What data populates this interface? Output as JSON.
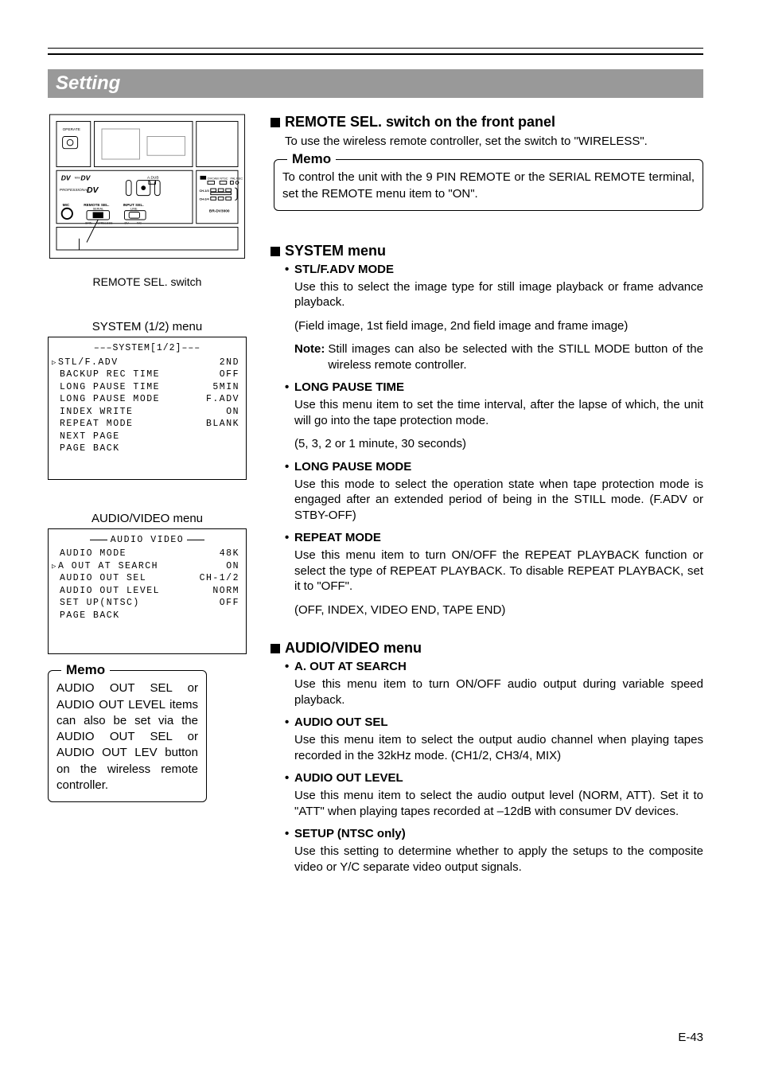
{
  "title": "Setting",
  "page_number": "E-43",
  "left": {
    "remote_switch_caption": "REMOTE SEL. switch",
    "system_menu_caption": "SYSTEM (1/2) menu",
    "system_menu_header": "–––SYSTEM[1/2]–––",
    "system_menu_items": [
      {
        "k": "STL/F.ADV",
        "v": "2ND",
        "cursor": true
      },
      {
        "k": "BACKUP REC TIME",
        "v": "OFF"
      },
      {
        "k": "LONG PAUSE TIME",
        "v": "5MIN"
      },
      {
        "k": "LONG PAUSE MODE",
        "v": "F.ADV"
      },
      {
        "k": "INDEX WRITE",
        "v": "ON"
      },
      {
        "k": "REPEAT MODE",
        "v": "BLANK"
      },
      {
        "k": "NEXT PAGE",
        "v": ""
      },
      {
        "k": "PAGE BACK",
        "v": ""
      }
    ],
    "av_menu_caption": "AUDIO/VIDEO menu",
    "av_menu_header": "AUDIO VIDEO",
    "av_menu_items": [
      {
        "k": "AUDIO MODE",
        "v": "48K"
      },
      {
        "k": "A OUT AT SEARCH",
        "v": "ON",
        "cursor": true
      },
      {
        "k": "AUDIO OUT SEL",
        "v": "CH-1/2"
      },
      {
        "k": "AUDIO OUT LEVEL",
        "v": "NORM"
      },
      {
        "k": "SET UP(NTSC)",
        "v": "OFF"
      },
      {
        "k": "PAGE BACK",
        "v": ""
      }
    ],
    "memo_title": "Memo",
    "memo_body": "AUDIO OUT SEL or AUDIO OUT LEVEL items can also be set via the AUDIO OUT SEL or AUDIO OUT LEV button on the wireless remote controller."
  },
  "right": {
    "remote_heading": "REMOTE SEL. switch on the front panel",
    "remote_lead": "To use the wireless remote controller, set the switch to \"WIRELESS\".",
    "remote_memo_title": "Memo",
    "remote_memo_body": "To control the unit with the 9 PIN REMOTE or the SERIAL REMOTE terminal, set the REMOTE menu item to \"ON\".",
    "system_heading": "SYSTEM menu",
    "system_items": [
      {
        "title": "STL/F.ADV MODE",
        "desc": "Use this to select the image type for still image playback or frame advance playback.\n(Field image, 1st field image, 2nd field image and frame image)",
        "note_label": "Note:",
        "note": "Still images can also be selected with the STILL MODE button of the wireless remote controller."
      },
      {
        "title": "LONG PAUSE TIME",
        "desc": "Use this menu item to set the time interval, after the lapse of which, the unit will go into the tape protection mode.\n(5, 3, 2 or 1 minute, 30 seconds)"
      },
      {
        "title": "LONG PAUSE MODE",
        "desc": "Use this mode to select the operation state when tape protection mode is engaged after an extended period of being in the STILL mode. (F.ADV or STBY-OFF)"
      },
      {
        "title": "REPEAT MODE",
        "desc": "Use this menu item to turn ON/OFF the REPEAT PLAYBACK function or select the type of REPEAT PLAYBACK. To disable REPEAT PLAYBACK, set it to \"OFF\".\n(OFF, INDEX, VIDEO END, TAPE END)"
      }
    ],
    "av_heading": "AUDIO/VIDEO menu",
    "av_items": [
      {
        "title": "A. OUT AT SEARCH",
        "desc": "Use this menu item to turn ON/OFF audio output during variable speed playback."
      },
      {
        "title": "AUDIO OUT SEL",
        "desc": "Use this menu item to select the output audio channel when playing tapes recorded in the 32kHz mode. (CH1/2, CH3/4, MIX)"
      },
      {
        "title": "AUDIO OUT LEVEL",
        "desc": "Use this menu item to select the audio output level (NORM, ATT). Set it to \"ATT\" when playing tapes recorded at –12dB with consumer DV devices."
      },
      {
        "title": "SETUP (NTSC only)",
        "desc": "Use this setting to determine whether to apply the setups to the composite video or Y/C separate video output signals."
      }
    ]
  }
}
